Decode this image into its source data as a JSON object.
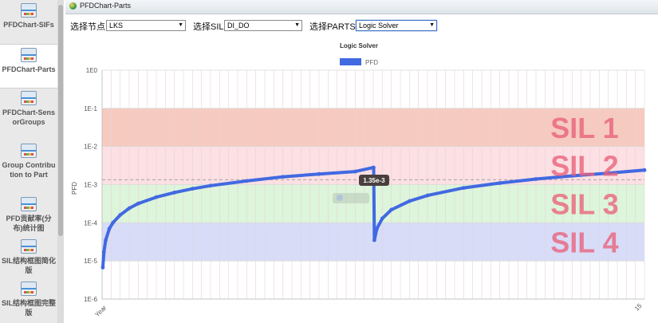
{
  "sidebar": {
    "items": [
      {
        "label": "PFDChart-SIFs",
        "active": false
      },
      {
        "label": "PFDChart-Parts",
        "active": true
      },
      {
        "label": "PFDChart-SensorGroups",
        "active": false
      },
      {
        "label": "Group Contribution to Part",
        "active": false
      },
      {
        "label": "PFD贡献率(分布)统计图",
        "active": false
      },
      {
        "label": "SIL结构框图简化版",
        "active": false
      },
      {
        "label": "SIL结构框图完整版",
        "active": false
      }
    ]
  },
  "window": {
    "title": "PFDChart-Parts",
    "icon": "app-globe-icon"
  },
  "selectors": {
    "node": {
      "label": "选择节点",
      "value": "LKS"
    },
    "sil": {
      "label": "选择SIL",
      "value": "DI_DO"
    },
    "parts": {
      "label": "选择PARTS",
      "value": "Logic Solver"
    }
  },
  "chart_data": {
    "type": "line",
    "title": "Logic Solver",
    "legend": {
      "position": "top-center",
      "entries": [
        "PFD"
      ]
    },
    "ylabel": "PFD",
    "xlabel": "",
    "y_scale": "log",
    "ylim": [
      "1E-6",
      "1E0"
    ],
    "y_ticks": [
      "1E0",
      "1E-1",
      "1E-2",
      "1E-3",
      "1E-4",
      "1E-5",
      "1E-6"
    ],
    "x_tick_labels": {
      "start": "Year",
      "end": "15"
    },
    "xlim": [
      0,
      15
    ],
    "grid": true,
    "target_line": 0.00135,
    "series": [
      {
        "name": "PFD",
        "color": "#4169e1",
        "x": [
          0.02,
          0.05,
          0.1,
          0.2,
          0.3,
          0.5,
          0.75,
          1,
          1.5,
          2,
          2.5,
          3,
          4,
          5,
          6,
          7,
          7.5,
          7.51,
          7.53,
          7.6,
          7.75,
          8,
          8.5,
          9,
          10,
          11,
          12,
          13,
          14,
          15
        ],
        "y": [
          6.7e-06,
          1.7e-05,
          3.5e-05,
          7e-05,
          0.0001,
          0.00016,
          0.00024,
          0.00032,
          0.00047,
          0.00062,
          0.00078,
          0.00094,
          0.00125,
          0.0016,
          0.0019,
          0.0022,
          0.0028,
          0.0028,
          3.5e-05,
          7e-05,
          0.00013,
          0.00022,
          0.00037,
          0.00052,
          0.00082,
          0.0011,
          0.0014,
          0.0017,
          0.002,
          0.0024
        ]
      }
    ],
    "bands": [
      {
        "label": "SIL 1",
        "range": [
          0.01,
          0.1
        ],
        "color": "#f3b8a8"
      },
      {
        "label": "SIL 2",
        "range": [
          0.001,
          0.01
        ],
        "color": "#fbd6d9"
      },
      {
        "label": "SIL 3",
        "range": [
          0.0001,
          0.001
        ],
        "color": "#d2f2cd"
      },
      {
        "label": "SIL 4",
        "range": [
          1e-05,
          0.0001
        ],
        "color": "#c9d2f6"
      }
    ],
    "tooltip": {
      "text": "1.35e-3"
    },
    "colors": {
      "line": "#4169e1",
      "tooltip_bg": "#4a3f3f",
      "grid": "#e6d3dc"
    }
  }
}
